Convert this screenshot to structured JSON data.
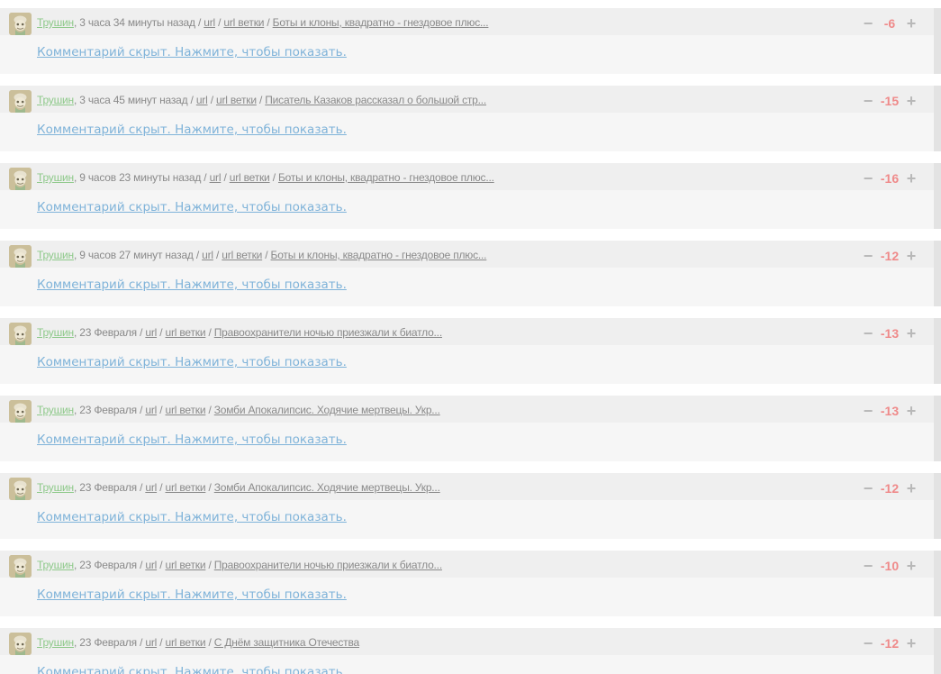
{
  "comments": [
    {
      "author": "Трушин",
      "time": "3 часа 34 минуты назад",
      "url_label": "url",
      "branch_label": "url ветки",
      "topic": "Боты и клоны, квадратно - гнездовое плюс...",
      "score": "-6",
      "hidden_text": "Комментарий скрыт. Нажмите, чтобы показать."
    },
    {
      "author": "Трушин",
      "time": "3 часа 45 минут назад",
      "url_label": "url",
      "branch_label": "url ветки",
      "topic": "Писатель Казаков рассказал о большой стр...",
      "score": "-15",
      "hidden_text": "Комментарий скрыт. Нажмите, чтобы показать."
    },
    {
      "author": "Трушин",
      "time": "9 часов 23 минуты назад",
      "url_label": "url",
      "branch_label": "url ветки",
      "topic": "Боты и клоны, квадратно - гнездовое плюс...",
      "score": "-16",
      "hidden_text": "Комментарий скрыт. Нажмите, чтобы показать."
    },
    {
      "author": "Трушин",
      "time": "9 часов 27 минут назад",
      "url_label": "url",
      "branch_label": "url ветки",
      "topic": "Боты и клоны, квадратно - гнездовое плюс...",
      "score": "-12",
      "hidden_text": "Комментарий скрыт. Нажмите, чтобы показать."
    },
    {
      "author": "Трушин",
      "time": "23 Февраля",
      "url_label": "url",
      "branch_label": "url ветки",
      "topic": "Правоохранители ночью приезжали к биатло...",
      "score": "-13",
      "hidden_text": "Комментарий скрыт. Нажмите, чтобы показать."
    },
    {
      "author": "Трушин",
      "time": "23 Февраля",
      "url_label": "url",
      "branch_label": "url ветки",
      "topic": "Зомби Апокалипсис. Ходячие мертвецы. Укр...",
      "score": "-13",
      "hidden_text": "Комментарий скрыт. Нажмите, чтобы показать."
    },
    {
      "author": "Трушин",
      "time": "23 Февраля",
      "url_label": "url",
      "branch_label": "url ветки",
      "topic": "Зомби Апокалипсис. Ходячие мертвецы. Укр...",
      "score": "-12",
      "hidden_text": "Комментарий скрыт. Нажмите, чтобы показать."
    },
    {
      "author": "Трушин",
      "time": "23 Февраля",
      "url_label": "url",
      "branch_label": "url ветки",
      "topic": "Правоохранители ночью приезжали к биатло...",
      "score": "-10",
      "hidden_text": "Комментарий скрыт. Нажмите, чтобы показать."
    },
    {
      "author": "Трушин",
      "time": "23 Февраля",
      "url_label": "url",
      "branch_label": "url ветки",
      "topic": "С Днём защитника Отечества",
      "score": "-12",
      "hidden_text": "Комментарий скрыт. Нажмите, чтобы показать."
    }
  ],
  "vote_minus_glyph": "−",
  "vote_plus_glyph": "+",
  "separators": {
    "comma": ", ",
    "slash": " / "
  },
  "colors": {
    "author": "#8ec98a",
    "score_negative": "#ef8a8a",
    "hidden_link": "#7fb3d9",
    "meta": "#8a8a8a"
  },
  "icons": {
    "avatar": "avatar-icon"
  }
}
